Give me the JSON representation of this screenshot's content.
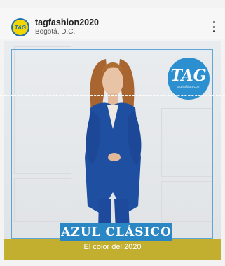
{
  "post": {
    "username": "tagfashion2020",
    "location": "Bogotá, D.C.",
    "avatar_text": "TAG"
  },
  "image": {
    "logo_text": "TAG",
    "logo_sub": "tagfashion.com",
    "headline": "AZUL CLÁSICO",
    "subline": "El color del 2020"
  },
  "colors": {
    "brand_blue": "#2a87c4",
    "band_gold": "#c2ae2f",
    "avatar_yellow": "#f3d600"
  },
  "icons": {
    "more": "more-vertical-icon"
  }
}
